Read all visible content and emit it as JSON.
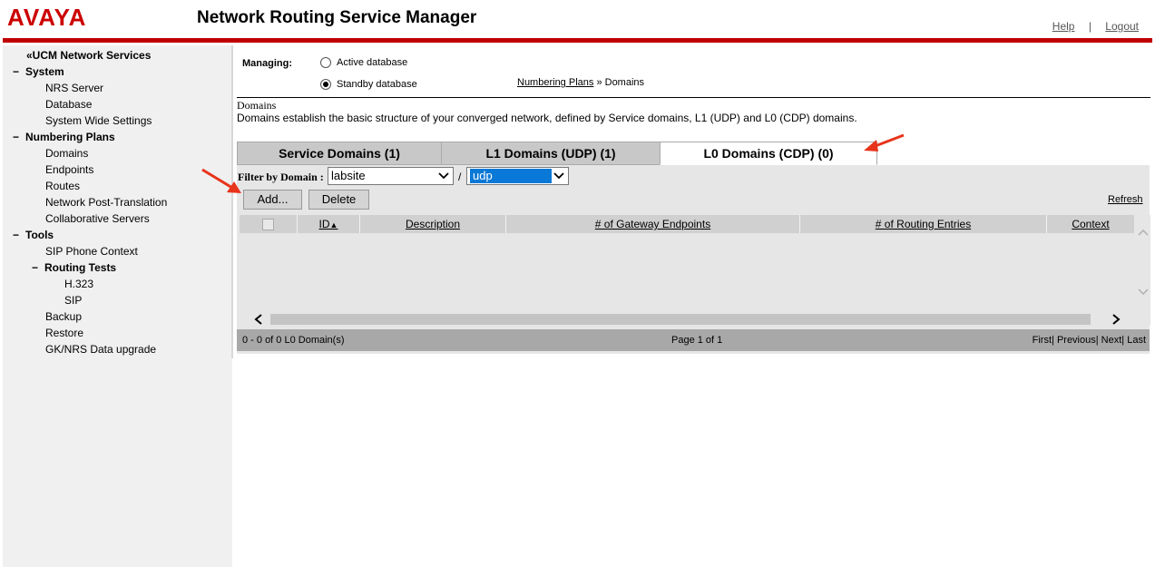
{
  "header": {
    "logo": "AVAYA",
    "title": "Network Routing Service Manager",
    "help": "Help",
    "separator": "|",
    "logout": "Logout",
    "brand_color": "#cc0000"
  },
  "sidebar": {
    "back_link": "«UCM Network Services",
    "system": {
      "label": "System",
      "items": [
        "NRS Server",
        "Database",
        "System Wide Settings"
      ]
    },
    "numbering_plans": {
      "label": "Numbering Plans",
      "items": [
        "Domains",
        "Endpoints",
        "Routes",
        "Network Post-Translation",
        "Collaborative Servers"
      ]
    },
    "tools": {
      "label": "Tools",
      "items": [
        "SIP Phone Context"
      ],
      "routing_tests": {
        "label": "Routing Tests",
        "items": [
          "H.323",
          "SIP"
        ]
      },
      "items_after": [
        "Backup",
        "Restore",
        "GK/NRS Data upgrade"
      ]
    },
    "collapse_glyph": "−"
  },
  "main": {
    "managing_label": "Managing:",
    "db_options": [
      {
        "label": "Active database",
        "selected": false
      },
      {
        "label": "Standby database",
        "selected": true
      }
    ],
    "breadcrumb": {
      "link": "Numbering Plans",
      "sep": "»",
      "current": "Domains"
    },
    "section_title": "Domains",
    "section_desc": "Domains establish the basic structure of your converged network, defined by Service domains, L1 (UDP) and L0 (CDP) domains.",
    "tabs": [
      {
        "label": "Service Domains (1)",
        "active": false
      },
      {
        "label": "L1 Domains (UDP) (1)",
        "active": false
      },
      {
        "label": "L0 Domains (CDP) (0)",
        "active": true
      }
    ],
    "filter": {
      "label": "Filter by Domain :",
      "domain_value": "labsite",
      "slash": "/",
      "sub_value": "udp"
    },
    "buttons": {
      "add": "Add...",
      "delete": "Delete",
      "refresh": "Refresh"
    },
    "grid": {
      "columns": [
        "ID",
        "Description",
        "# of Gateway Endpoints",
        "# of Routing Entries",
        "Context"
      ],
      "sort_indicator": "▲",
      "rows": []
    },
    "footer": {
      "count": "0 - 0 of 0 L0 Domain(s)",
      "page": "Page 1 of 1",
      "first": "First",
      "previous": "Previous",
      "next": "Next",
      "last": "Last",
      "pipe": "|"
    }
  },
  "annotation_color": "#e8341c"
}
